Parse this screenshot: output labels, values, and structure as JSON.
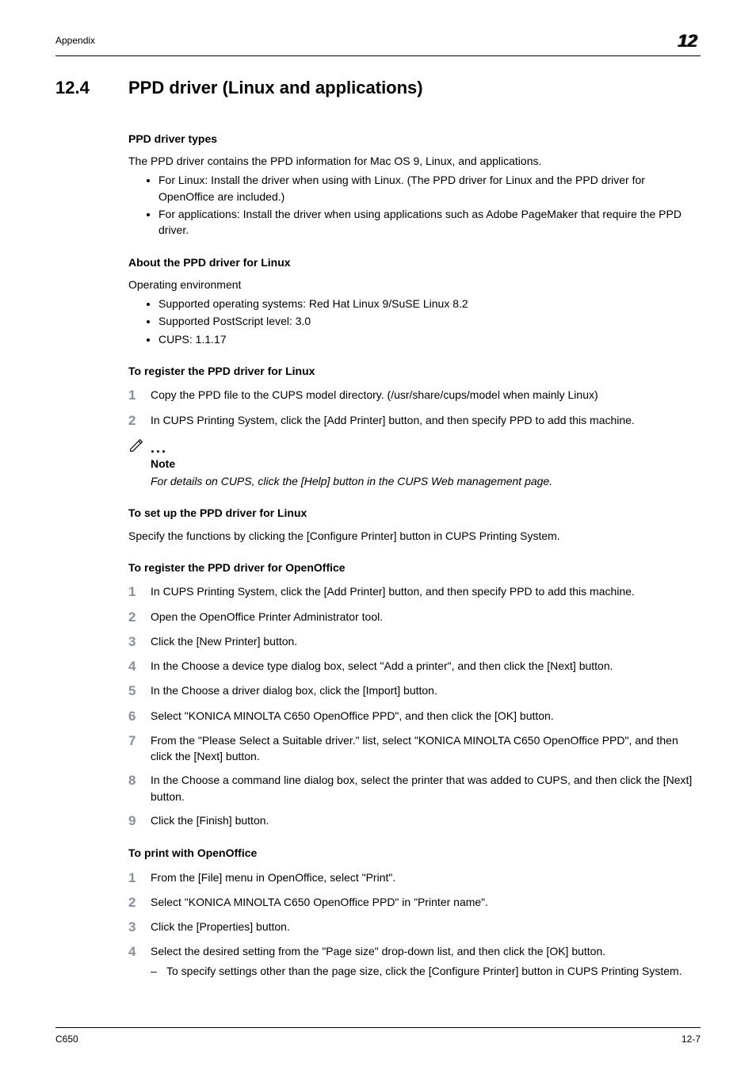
{
  "header": {
    "left": "Appendix",
    "right": "12"
  },
  "section": {
    "num": "12.4",
    "title": "PPD driver (Linux and applications)"
  },
  "ppd_types": {
    "heading": "PPD driver types",
    "intro": "The PPD driver contains the PPD information for Mac OS 9, Linux, and applications.",
    "bullets": [
      "For Linux: Install the driver when using with Linux. (The PPD driver for Linux and the PPD driver for OpenOffice are included.)",
      "For applications: Install the driver when using applications such as Adobe PageMaker that require the PPD driver."
    ]
  },
  "about_linux": {
    "heading": "About the PPD driver for Linux",
    "intro": "Operating environment",
    "bullets": [
      "Supported operating systems: Red Hat Linux 9/SuSE Linux 8.2",
      "Supported PostScript level: 3.0",
      "CUPS: 1.1.17"
    ]
  },
  "reg_linux": {
    "heading": "To register the PPD driver for Linux",
    "steps": [
      "Copy the PPD file to the CUPS model directory. (/usr/share/cups/model when mainly Linux)",
      "In CUPS Printing System, click the [Add Printer] button, and then specify PPD to add this machine."
    ]
  },
  "note": {
    "label": "Note",
    "body": "For details on CUPS, click the [Help] button in the CUPS Web management page."
  },
  "setup_linux": {
    "heading": "To set up the PPD driver for Linux",
    "para": "Specify the functions by clicking the [Configure Printer] button in CUPS Printing System."
  },
  "reg_oo": {
    "heading": "To register the PPD driver for OpenOffice",
    "steps": [
      "In CUPS Printing System, click the [Add Printer] button, and then specify PPD to add this machine.",
      "Open the OpenOffice Printer Administrator tool.",
      "Click the [New Printer] button.",
      "In the Choose a device type dialog box, select \"Add a printer\", and then click the [Next] button.",
      "In the Choose a driver dialog box, click the [Import] button.",
      "Select \"KONICA MINOLTA C650 OpenOffice PPD\", and then click the [OK] button.",
      "From the \"Please Select a Suitable driver.\" list, select \"KONICA MINOLTA C650 OpenOffice PPD\", and then click the [Next] button.",
      "In the Choose a command line dialog box, select the printer that was added to CUPS, and then click the [Next] button.",
      "Click the [Finish] button."
    ]
  },
  "print_oo": {
    "heading": "To print with OpenOffice",
    "steps": [
      "From the [File] menu in OpenOffice, select \"Print\".",
      "Select \"KONICA MINOLTA C650 OpenOffice PPD\" in \"Printer name\".",
      "Click the [Properties] button.",
      "Select the desired setting from the \"Page size\" drop-down list, and then click the [OK] button."
    ],
    "sub4": "To specify settings other than the page size, click the [Configure Printer] button in CUPS Printing System."
  },
  "footer": {
    "left": "C650",
    "right": "12-7"
  }
}
